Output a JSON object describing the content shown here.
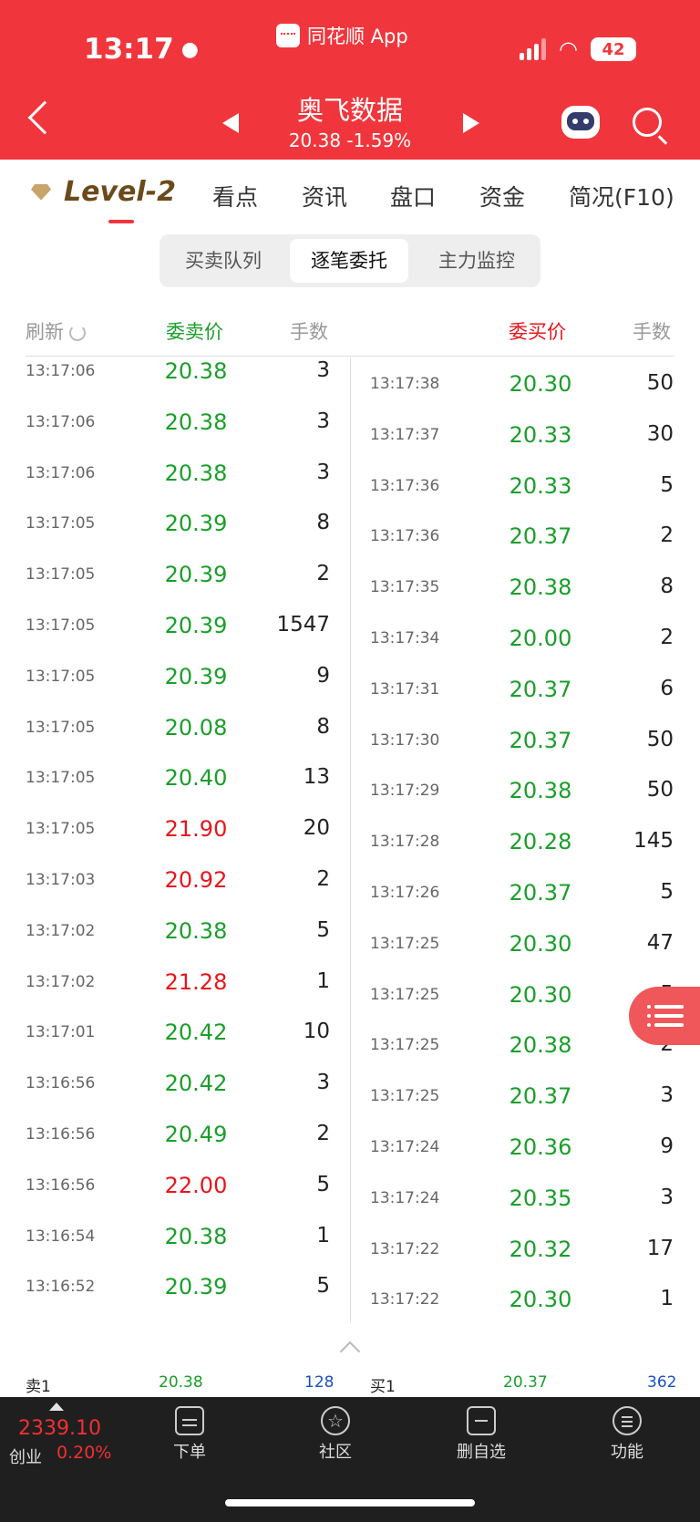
{
  "status": {
    "time": "13:17",
    "app_name": "同花顺 App",
    "battery": "42"
  },
  "stock": {
    "name": "奥飞数据",
    "price_change": "20.38 -1.59%"
  },
  "tabs": [
    "Level-2",
    "看点",
    "资讯",
    "盘口",
    "资金",
    "简况(F10)"
  ],
  "segments": [
    "买卖队列",
    "逐笔委托",
    "主力监控"
  ],
  "columns": {
    "refresh": "刷新",
    "sell_price": "委卖价",
    "sell_qty": "手数",
    "buy_price": "委买价",
    "buy_qty": "手数"
  },
  "colors": {
    "header_red": "#f0363c",
    "green": "#1a9e2a",
    "red": "#e8151b",
    "blue": "#1a4fc8"
  },
  "sell_rows": [
    {
      "time": "13:17:06",
      "price": "20.38",
      "qty": "3",
      "color": "green"
    },
    {
      "time": "13:17:06",
      "price": "20.38",
      "qty": "3",
      "color": "green"
    },
    {
      "time": "13:17:06",
      "price": "20.38",
      "qty": "3",
      "color": "green"
    },
    {
      "time": "13:17:05",
      "price": "20.39",
      "qty": "8",
      "color": "green"
    },
    {
      "time": "13:17:05",
      "price": "20.39",
      "qty": "2",
      "color": "green"
    },
    {
      "time": "13:17:05",
      "price": "20.39",
      "qty": "1547",
      "color": "green"
    },
    {
      "time": "13:17:05",
      "price": "20.39",
      "qty": "9",
      "color": "green"
    },
    {
      "time": "13:17:05",
      "price": "20.08",
      "qty": "8",
      "color": "green"
    },
    {
      "time": "13:17:05",
      "price": "20.40",
      "qty": "13",
      "color": "green"
    },
    {
      "time": "13:17:05",
      "price": "21.90",
      "qty": "20",
      "color": "red"
    },
    {
      "time": "13:17:03",
      "price": "20.92",
      "qty": "2",
      "color": "red"
    },
    {
      "time": "13:17:02",
      "price": "20.38",
      "qty": "5",
      "color": "green"
    },
    {
      "time": "13:17:02",
      "price": "21.28",
      "qty": "1",
      "color": "red"
    },
    {
      "time": "13:17:01",
      "price": "20.42",
      "qty": "10",
      "color": "green"
    },
    {
      "time": "13:16:56",
      "price": "20.42",
      "qty": "3",
      "color": "green"
    },
    {
      "time": "13:16:56",
      "price": "20.49",
      "qty": "2",
      "color": "green"
    },
    {
      "time": "13:16:56",
      "price": "22.00",
      "qty": "5",
      "color": "red"
    },
    {
      "time": "13:16:54",
      "price": "20.38",
      "qty": "1",
      "color": "green"
    },
    {
      "time": "13:16:52",
      "price": "20.39",
      "qty": "5",
      "color": "green"
    }
  ],
  "buy_rows": [
    {
      "time": "13:17:38",
      "price": "20.30",
      "qty": "50",
      "color": "green"
    },
    {
      "time": "13:17:37",
      "price": "20.33",
      "qty": "30",
      "color": "green"
    },
    {
      "time": "13:17:36",
      "price": "20.33",
      "qty": "5",
      "color": "green"
    },
    {
      "time": "13:17:36",
      "price": "20.37",
      "qty": "2",
      "color": "green"
    },
    {
      "time": "13:17:35",
      "price": "20.38",
      "qty": "8",
      "color": "green"
    },
    {
      "time": "13:17:34",
      "price": "20.00",
      "qty": "2",
      "color": "green"
    },
    {
      "time": "13:17:31",
      "price": "20.37",
      "qty": "6",
      "color": "green"
    },
    {
      "time": "13:17:30",
      "price": "20.37",
      "qty": "50",
      "color": "green"
    },
    {
      "time": "13:17:29",
      "price": "20.38",
      "qty": "50",
      "color": "green"
    },
    {
      "time": "13:17:28",
      "price": "20.28",
      "qty": "145",
      "color": "green"
    },
    {
      "time": "13:17:26",
      "price": "20.37",
      "qty": "5",
      "color": "green"
    },
    {
      "time": "13:17:25",
      "price": "20.30",
      "qty": "47",
      "color": "green"
    },
    {
      "time": "13:17:25",
      "price": "20.30",
      "qty": "5",
      "color": "green"
    },
    {
      "time": "13:17:25",
      "price": "20.38",
      "qty": "2",
      "color": "green"
    },
    {
      "time": "13:17:25",
      "price": "20.37",
      "qty": "3",
      "color": "green"
    },
    {
      "time": "13:17:24",
      "price": "20.36",
      "qty": "9",
      "color": "green"
    },
    {
      "time": "13:17:24",
      "price": "20.35",
      "qty": "3",
      "color": "green"
    },
    {
      "time": "13:17:22",
      "price": "20.32",
      "qty": "17",
      "color": "green"
    },
    {
      "time": "13:17:22",
      "price": "20.30",
      "qty": "1",
      "color": "green"
    }
  ],
  "summary": {
    "sell_label": "卖1",
    "sell_price": "20.38",
    "sell_qty": "128",
    "buy_label": "买1",
    "buy_price": "20.37",
    "buy_qty": "362"
  },
  "index": {
    "value": "2339.10",
    "name": "创业",
    "pct": "0.20%"
  },
  "nav": [
    "下单",
    "社区",
    "删自选",
    "功能"
  ]
}
